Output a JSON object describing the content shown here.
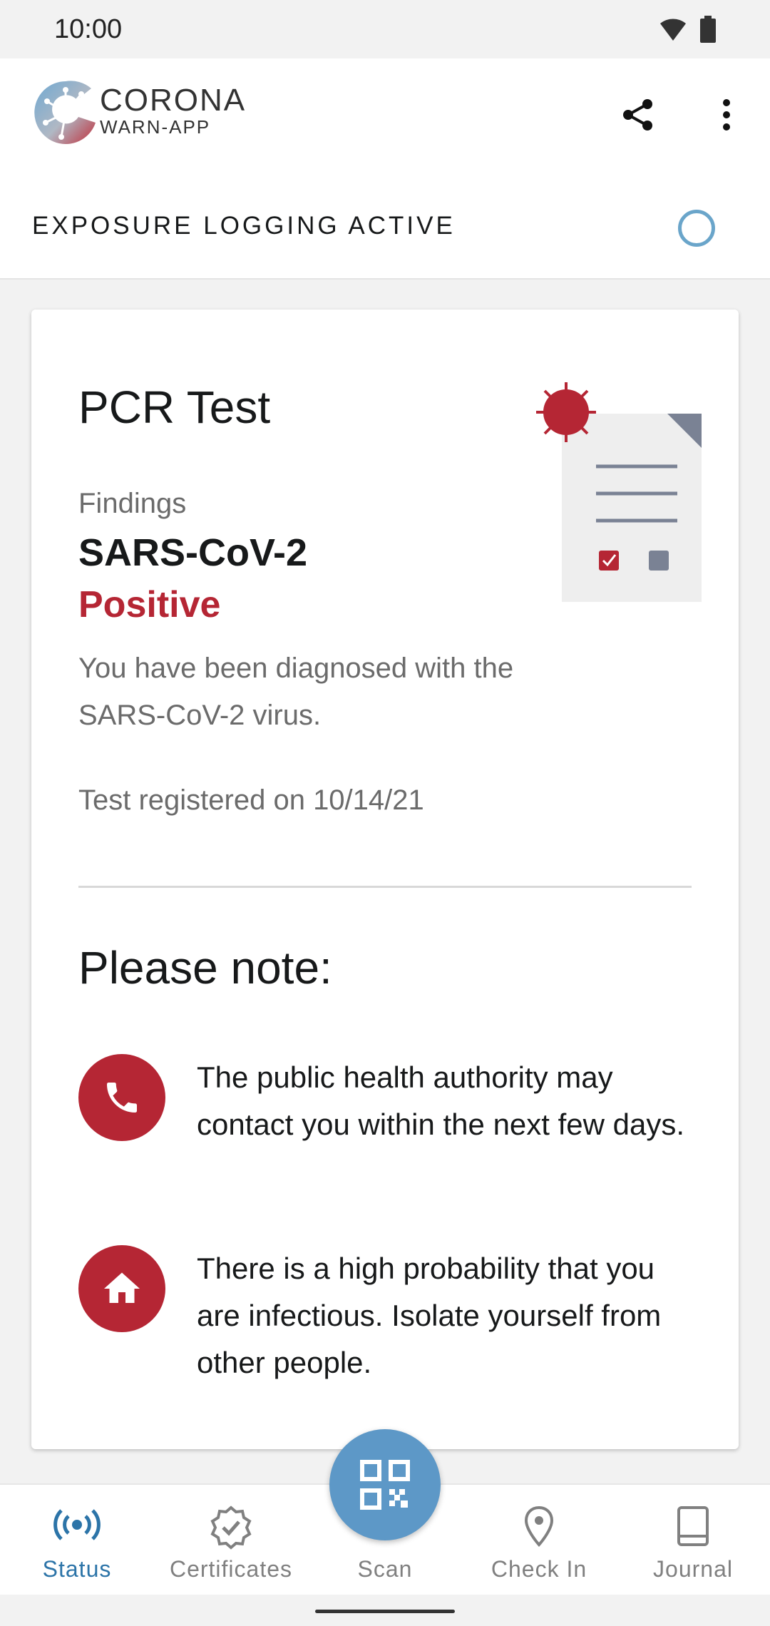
{
  "status_bar": {
    "time": "10:00"
  },
  "app_bar": {
    "brand_line1": "CORONA",
    "brand_line2": "WARN-APP"
  },
  "exposure": {
    "label": "EXPOSURE LOGGING ACTIVE"
  },
  "test_card": {
    "title": "PCR Test",
    "findings_label": "Findings",
    "virus_name": "SARS-CoV-2",
    "result": "Positive",
    "description": "You have been diagnosed with the SARS-CoV-2 virus.",
    "registered": "Test registered on 10/14/21",
    "note_title": "Please note:",
    "notes": [
      {
        "icon": "phone-icon",
        "text": "The public health authority may contact you within the next few days."
      },
      {
        "icon": "home-icon",
        "text": "There is a high probability that you are infectious. Isolate yourself from other people."
      }
    ]
  },
  "bottom_nav": {
    "items": [
      {
        "label": "Status",
        "icon": "exposure-radar-icon",
        "active": true
      },
      {
        "label": "Certificates",
        "icon": "certificate-badge-icon"
      },
      {
        "label": "Scan",
        "icon": "qr-code-icon"
      },
      {
        "label": "Check In",
        "icon": "location-pin-icon"
      },
      {
        "label": "Journal",
        "icon": "journal-book-icon"
      }
    ]
  },
  "colors": {
    "accent": "#b52634",
    "primary_blue": "#5d98c7",
    "active_nav": "#2c74a8"
  }
}
